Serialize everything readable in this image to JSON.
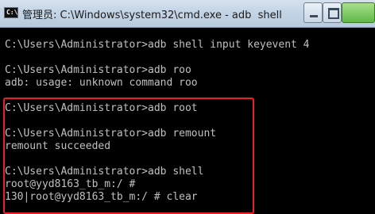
{
  "window": {
    "title": "管理员: C:\\Windows\\system32\\cmd.exe - adb  shell",
    "icon_text": "C:\\",
    "icons": [
      "cmd-icon",
      "minimize-icon",
      "maximize-icon",
      "close-icon"
    ]
  },
  "highlight_color": "#e8202a",
  "console": {
    "lines": [
      "C:\\Users\\Administrator>adb shell input keyevent 4",
      "C:\\Users\\Administrator>adb roo",
      "adb: usage: unknown command roo",
      "C:\\Users\\Administrator>adb root",
      "C:\\Users\\Administrator>adb remount",
      "remount succeeded",
      "C:\\Users\\Administrator>adb shell",
      "root@yyd8163_tb_m:/ #",
      "130|root@yyd8163_tb_m:/ # clear"
    ]
  }
}
